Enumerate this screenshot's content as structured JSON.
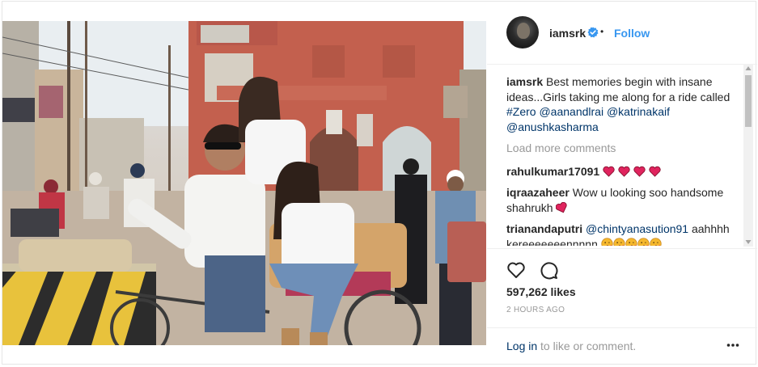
{
  "post": {
    "username": "iamsrk",
    "dot": "•",
    "follow_label": "Follow",
    "caption_user": "iamsrk",
    "caption_text": " Best memories begin with insane ideas...Girls taking me along for a ride called ",
    "caption_tags": [
      "#Zero",
      "@aanandlrai",
      "@katrinakaif",
      "@anushkasharma"
    ],
    "load_more": "Load more comments",
    "comments": [
      {
        "user": "rahulkumar17091",
        "text": "",
        "emojis": [
          "heart",
          "heart",
          "heart",
          "heart"
        ]
      },
      {
        "user": "iqraazaheer",
        "text": " Wow u looking soo handsome shahrukh ",
        "emojis": [
          "heart-tilted"
        ]
      },
      {
        "user": "trianandaputri",
        "mention": "@chintyanasution91",
        "text": " aahhhh kereeeeeeennnnn ",
        "emojis": [
          "kiss",
          "kiss",
          "kiss",
          "kiss",
          "kiss"
        ]
      }
    ],
    "likes": "597,262 likes",
    "time_ago": "2 HOURS AGO",
    "login_link": "Log in",
    "login_text": " to like or comment.",
    "icons": {
      "like": "heart-outline-icon",
      "comment": "comment-bubble-icon",
      "more": "more-options-icon",
      "verified": "verified-badge-icon"
    },
    "colors": {
      "link": "#003569",
      "follow": "#3897f0",
      "muted": "#999999",
      "heart_red": "#ed4956",
      "verified": "#3897f0"
    }
  }
}
